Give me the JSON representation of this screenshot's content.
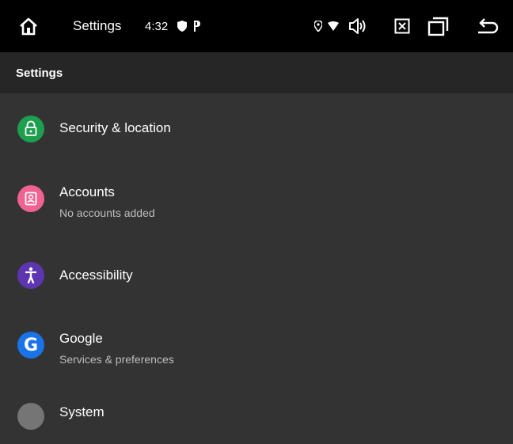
{
  "status_bar": {
    "app_title": "Settings",
    "time": "4:32",
    "icons": [
      "home-icon",
      "shield-icon",
      "parking-icon",
      "location-icon",
      "wifi-icon",
      "volume-icon",
      "close-box-icon",
      "recent-apps-icon",
      "back-icon"
    ]
  },
  "app_bar": {
    "title": "Settings"
  },
  "settings_items": [
    {
      "title": "Security & location",
      "subtitle": "",
      "icon": "lock-icon",
      "color": "#1E9E4F"
    },
    {
      "title": "Accounts",
      "subtitle": "No accounts added",
      "icon": "account-icon",
      "color": "#F06292"
    },
    {
      "title": "Accessibility",
      "subtitle": "",
      "icon": "accessibility-icon",
      "color": "#5E35B1"
    },
    {
      "title": "Google",
      "subtitle": "Services & preferences",
      "icon": "google-icon",
      "color": "#1A73E8"
    },
    {
      "title": "System",
      "subtitle": "",
      "icon": "system-icon",
      "color": "#757575"
    }
  ],
  "colors": {
    "status_bar_bg": "#000000",
    "app_bar_bg": "#262626",
    "content_bg": "#333333",
    "subtitle_text": "#BDBDBD"
  }
}
